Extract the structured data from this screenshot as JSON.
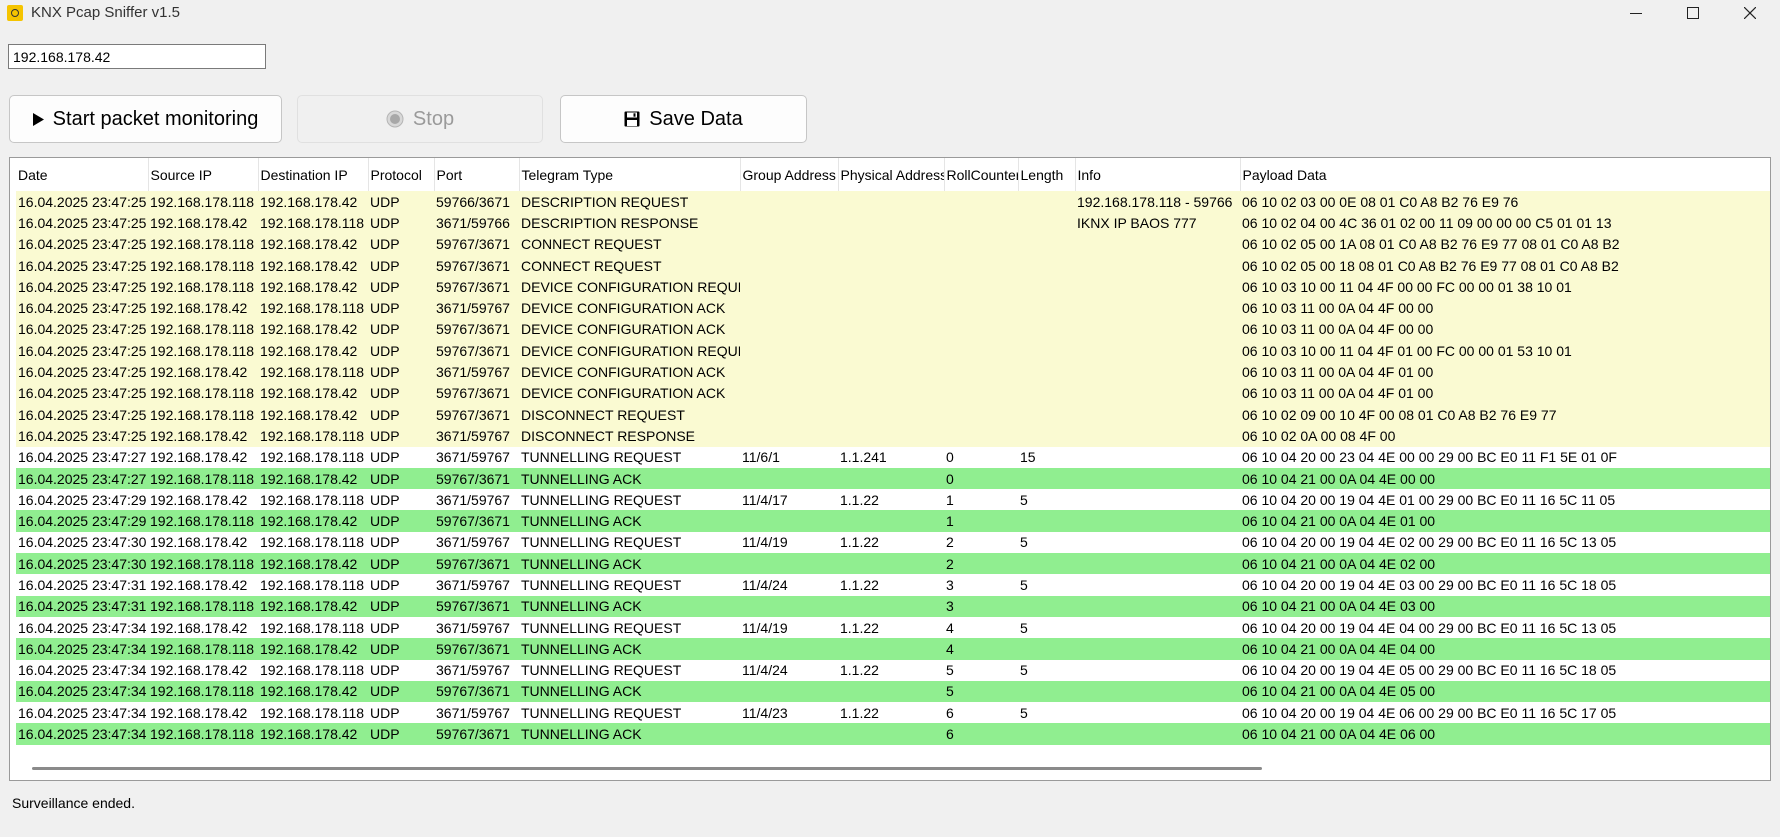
{
  "window": {
    "title": "KNX Pcap Sniffer v1.5",
    "icon": "knx-app-icon"
  },
  "ip_field": {
    "value": "192.168.178.42"
  },
  "toolbar": {
    "start_label": "Start packet monitoring",
    "stop_label": "Stop",
    "save_label": "Save Data"
  },
  "colors": {
    "control_row": "#fafad2",
    "ack_row": "#90ee90",
    "request_row": "#ffffff"
  },
  "table": {
    "columns": [
      "Date",
      "Source IP",
      "Destination IP",
      "Protocol",
      "Port",
      "Telegram Type",
      "Group Address",
      "Physical Address",
      "RollCounter",
      "Length",
      "Info",
      "Payload Data"
    ],
    "rows": [
      {
        "kind": "control",
        "cells": [
          "16.04.2025 23:47:25",
          "192.168.178.118",
          "192.168.178.42",
          "UDP",
          "59766/3671",
          "DESCRIPTION REQUEST",
          "",
          "",
          "",
          "",
          "192.168.178.118 - 59766",
          "06 10 02 03 00 0E 08 01 C0 A8 B2 76 E9 76"
        ]
      },
      {
        "kind": "control",
        "cells": [
          "16.04.2025 23:47:25",
          "192.168.178.42",
          "192.168.178.118",
          "UDP",
          "3671/59766",
          "DESCRIPTION RESPONSE",
          "",
          "",
          "",
          "",
          "IKNX IP BAOS 777",
          "06 10 02 04 00 4C 36 01 02 00 11 09 00 00 00 C5 01 01 13"
        ]
      },
      {
        "kind": "control",
        "cells": [
          "16.04.2025 23:47:25",
          "192.168.178.118",
          "192.168.178.42",
          "UDP",
          "59767/3671",
          "CONNECT REQUEST",
          "",
          "",
          "",
          "",
          "",
          "06 10 02 05 00 1A 08 01 C0 A8 B2 76 E9 77 08 01 C0 A8 B2"
        ]
      },
      {
        "kind": "control",
        "cells": [
          "16.04.2025 23:47:25",
          "192.168.178.118",
          "192.168.178.42",
          "UDP",
          "59767/3671",
          "CONNECT REQUEST",
          "",
          "",
          "",
          "",
          "",
          "06 10 02 05 00 18 08 01 C0 A8 B2 76 E9 77 08 01 C0 A8 B2"
        ]
      },
      {
        "kind": "control",
        "cells": [
          "16.04.2025 23:47:25",
          "192.168.178.118",
          "192.168.178.42",
          "UDP",
          "59767/3671",
          "DEVICE CONFIGURATION REQUEST",
          "",
          "",
          "",
          "",
          "",
          "06 10 03 10 00 11 04 4F 00 00 FC 00 00 01 38 10 01"
        ]
      },
      {
        "kind": "control",
        "cells": [
          "16.04.2025 23:47:25",
          "192.168.178.42",
          "192.168.178.118",
          "UDP",
          "3671/59767",
          "DEVICE CONFIGURATION ACK",
          "",
          "",
          "",
          "",
          "",
          "06 10 03 11 00 0A 04 4F 00 00"
        ]
      },
      {
        "kind": "control",
        "cells": [
          "16.04.2025 23:47:25",
          "192.168.178.118",
          "192.168.178.42",
          "UDP",
          "59767/3671",
          "DEVICE CONFIGURATION ACK",
          "",
          "",
          "",
          "",
          "",
          "06 10 03 11 00 0A 04 4F 00 00"
        ]
      },
      {
        "kind": "control",
        "cells": [
          "16.04.2025 23:47:25",
          "192.168.178.118",
          "192.168.178.42",
          "UDP",
          "59767/3671",
          "DEVICE CONFIGURATION REQUEST",
          "",
          "",
          "",
          "",
          "",
          "06 10 03 10 00 11 04 4F 01 00 FC 00 00 01 53 10 01"
        ]
      },
      {
        "kind": "control",
        "cells": [
          "16.04.2025 23:47:25",
          "192.168.178.42",
          "192.168.178.118",
          "UDP",
          "3671/59767",
          "DEVICE CONFIGURATION ACK",
          "",
          "",
          "",
          "",
          "",
          "06 10 03 11 00 0A 04 4F 01 00"
        ]
      },
      {
        "kind": "control",
        "cells": [
          "16.04.2025 23:47:25",
          "192.168.178.118",
          "192.168.178.42",
          "UDP",
          "59767/3671",
          "DEVICE CONFIGURATION ACK",
          "",
          "",
          "",
          "",
          "",
          "06 10 03 11 00 0A 04 4F 01 00"
        ]
      },
      {
        "kind": "control",
        "cells": [
          "16.04.2025 23:47:25",
          "192.168.178.118",
          "192.168.178.42",
          "UDP",
          "59767/3671",
          "DISCONNECT REQUEST",
          "",
          "",
          "",
          "",
          "",
          "06 10 02 09 00 10 4F 00 08 01 C0 A8 B2 76 E9 77"
        ]
      },
      {
        "kind": "control",
        "cells": [
          "16.04.2025 23:47:25",
          "192.168.178.42",
          "192.168.178.118",
          "UDP",
          "3671/59767",
          "DISCONNECT RESPONSE",
          "",
          "",
          "",
          "",
          "",
          "06 10 02 0A 00 08 4F 00"
        ]
      },
      {
        "kind": "request",
        "cells": [
          "16.04.2025 23:47:27",
          "192.168.178.42",
          "192.168.178.118",
          "UDP",
          "3671/59767",
          "TUNNELLING REQUEST",
          "11/6/1",
          "1.1.241",
          "0",
          "15",
          "",
          "06 10 04 20 00 23 04 4E 00 00 29 00 BC E0 11 F1 5E 01 0F"
        ]
      },
      {
        "kind": "ack",
        "cells": [
          "16.04.2025 23:47:27",
          "192.168.178.118",
          "192.168.178.42",
          "UDP",
          "59767/3671",
          "TUNNELLING ACK",
          "",
          "",
          "0",
          "",
          "",
          "06 10 04 21 00 0A 04 4E 00 00"
        ]
      },
      {
        "kind": "request",
        "cells": [
          "16.04.2025 23:47:29",
          "192.168.178.42",
          "192.168.178.118",
          "UDP",
          "3671/59767",
          "TUNNELLING REQUEST",
          "11/4/17",
          "1.1.22",
          "1",
          "5",
          "",
          "06 10 04 20 00 19 04 4E 01 00 29 00 BC E0 11 16 5C 11 05"
        ]
      },
      {
        "kind": "ack",
        "cells": [
          "16.04.2025 23:47:29",
          "192.168.178.118",
          "192.168.178.42",
          "UDP",
          "59767/3671",
          "TUNNELLING ACK",
          "",
          "",
          "1",
          "",
          "",
          "06 10 04 21 00 0A 04 4E 01 00"
        ]
      },
      {
        "kind": "request",
        "cells": [
          "16.04.2025 23:47:30",
          "192.168.178.42",
          "192.168.178.118",
          "UDP",
          "3671/59767",
          "TUNNELLING REQUEST",
          "11/4/19",
          "1.1.22",
          "2",
          "5",
          "",
          "06 10 04 20 00 19 04 4E 02 00 29 00 BC E0 11 16 5C 13 05"
        ]
      },
      {
        "kind": "ack",
        "cells": [
          "16.04.2025 23:47:30",
          "192.168.178.118",
          "192.168.178.42",
          "UDP",
          "59767/3671",
          "TUNNELLING ACK",
          "",
          "",
          "2",
          "",
          "",
          "06 10 04 21 00 0A 04 4E 02 00"
        ]
      },
      {
        "kind": "request",
        "cells": [
          "16.04.2025 23:47:31",
          "192.168.178.42",
          "192.168.178.118",
          "UDP",
          "3671/59767",
          "TUNNELLING REQUEST",
          "11/4/24",
          "1.1.22",
          "3",
          "5",
          "",
          "06 10 04 20 00 19 04 4E 03 00 29 00 BC E0 11 16 5C 18 05"
        ]
      },
      {
        "kind": "ack",
        "cells": [
          "16.04.2025 23:47:31",
          "192.168.178.118",
          "192.168.178.42",
          "UDP",
          "59767/3671",
          "TUNNELLING ACK",
          "",
          "",
          "3",
          "",
          "",
          "06 10 04 21 00 0A 04 4E 03 00"
        ]
      },
      {
        "kind": "request",
        "cells": [
          "16.04.2025 23:47:34",
          "192.168.178.42",
          "192.168.178.118",
          "UDP",
          "3671/59767",
          "TUNNELLING REQUEST",
          "11/4/19",
          "1.1.22",
          "4",
          "5",
          "",
          "06 10 04 20 00 19 04 4E 04 00 29 00 BC E0 11 16 5C 13 05"
        ]
      },
      {
        "kind": "ack",
        "cells": [
          "16.04.2025 23:47:34",
          "192.168.178.118",
          "192.168.178.42",
          "UDP",
          "59767/3671",
          "TUNNELLING ACK",
          "",
          "",
          "4",
          "",
          "",
          "06 10 04 21 00 0A 04 4E 04 00"
        ]
      },
      {
        "kind": "request",
        "cells": [
          "16.04.2025 23:47:34",
          "192.168.178.42",
          "192.168.178.118",
          "UDP",
          "3671/59767",
          "TUNNELLING REQUEST",
          "11/4/24",
          "1.1.22",
          "5",
          "5",
          "",
          "06 10 04 20 00 19 04 4E 05 00 29 00 BC E0 11 16 5C 18 05"
        ]
      },
      {
        "kind": "ack",
        "cells": [
          "16.04.2025 23:47:34",
          "192.168.178.118",
          "192.168.178.42",
          "UDP",
          "59767/3671",
          "TUNNELLING ACK",
          "",
          "",
          "5",
          "",
          "",
          "06 10 04 21 00 0A 04 4E 05 00"
        ]
      },
      {
        "kind": "request",
        "cells": [
          "16.04.2025 23:47:34",
          "192.168.178.42",
          "192.168.178.118",
          "UDP",
          "3671/59767",
          "TUNNELLING REQUEST",
          "11/4/23",
          "1.1.22",
          "6",
          "5",
          "",
          "06 10 04 20 00 19 04 4E 06 00 29 00 BC E0 11 16 5C 17 05"
        ]
      },
      {
        "kind": "ack",
        "cells": [
          "16.04.2025 23:47:34",
          "192.168.178.118",
          "192.168.178.42",
          "UDP",
          "59767/3671",
          "TUNNELLING ACK",
          "",
          "",
          "6",
          "",
          "",
          "06 10 04 21 00 0A 04 4E 06 00"
        ]
      }
    ]
  },
  "status": {
    "text": "Surveillance ended."
  }
}
